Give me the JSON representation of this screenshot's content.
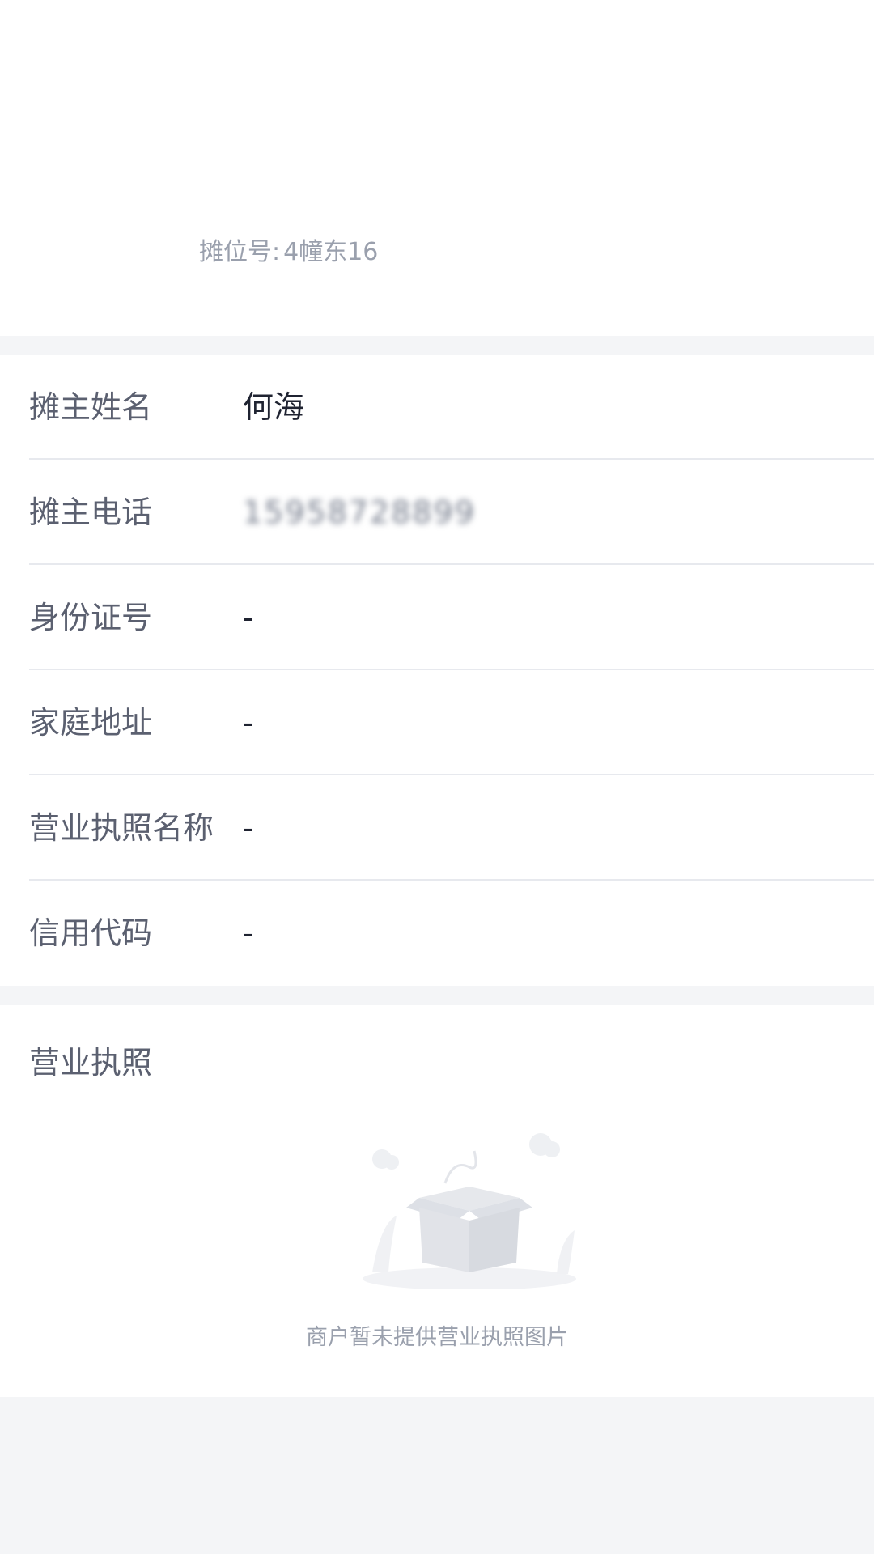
{
  "header": {
    "stall_label": "摊位号:",
    "stall_value": "4幢东16"
  },
  "info": {
    "rows": [
      {
        "label": "摊主姓名",
        "value": "何海"
      },
      {
        "label": "摊主电话",
        "value": "15958728899"
      },
      {
        "label": "身份证号",
        "value": "-"
      },
      {
        "label": "家庭地址",
        "value": "-"
      },
      {
        "label": "营业执照名称",
        "value": "-"
      },
      {
        "label": "信用代码",
        "value": "-"
      }
    ]
  },
  "license": {
    "title": "营业执照",
    "empty_text": "商户暂未提供营业执照图片",
    "empty_icon": "empty-box-icon"
  },
  "colors": {
    "background": "#f4f5f7",
    "card": "#ffffff",
    "label": "#5b6070",
    "value": "#1f2331",
    "muted": "#9aa0ad",
    "divider": "#e7e9ee"
  }
}
